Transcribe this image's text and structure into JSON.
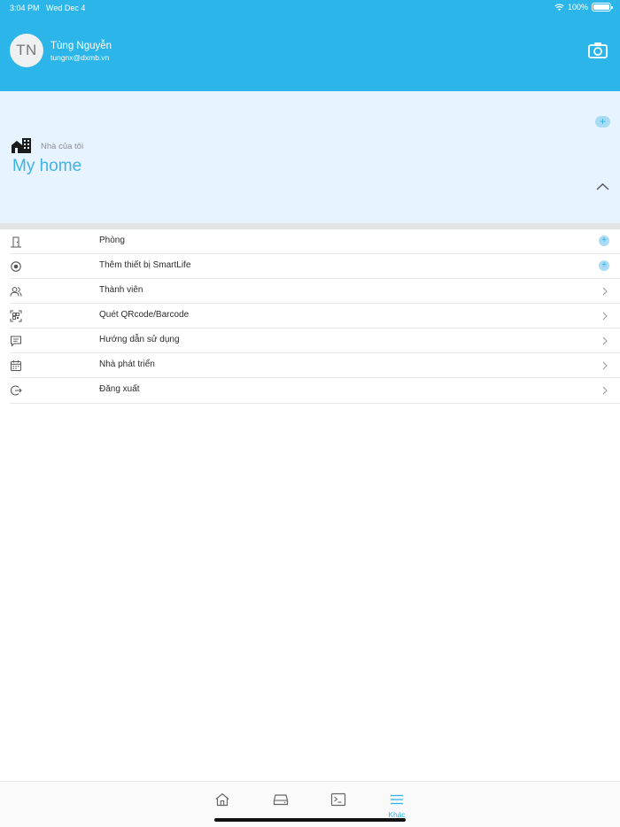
{
  "status_bar": {
    "time": "3:04 PM",
    "date": "Wed Dec 4",
    "battery": "100%",
    "icons": [
      "wifi-icon",
      "battery-icon"
    ]
  },
  "profile": {
    "initials": "TN",
    "name": "Tùng Nguyễn",
    "email": "tungnx@dxmb.vn",
    "camera_icon": "camera-icon"
  },
  "home": {
    "label": "Nhà của tôi",
    "name": "My home",
    "add_symbol": "+",
    "icons": [
      "home-buildings-icon",
      "chevron-up-icon"
    ]
  },
  "menu": {
    "items": [
      {
        "label": "Phòng",
        "icon": "door-icon",
        "action": "add"
      },
      {
        "label": "Thêm thiết bị SmartLife",
        "icon": "target-icon",
        "action": "add"
      },
      {
        "label": "Thành viên",
        "icon": "users-icon",
        "action": "chevron"
      },
      {
        "label": "Quét QRcode/Barcode",
        "icon": "qr-scan-icon",
        "action": "chevron"
      },
      {
        "label": "Hướng dẫn sử dụng",
        "icon": "message-icon",
        "action": "chevron"
      },
      {
        "label": "Nhà phát triển",
        "icon": "calendar-icon",
        "action": "chevron"
      },
      {
        "label": "Đăng xuất",
        "icon": "logout-icon",
        "action": "chevron"
      }
    ],
    "add_symbol": "+"
  },
  "tabbar": {
    "tabs": [
      {
        "icon": "home-icon",
        "label": ""
      },
      {
        "icon": "device-icon",
        "label": ""
      },
      {
        "icon": "terminal-icon",
        "label": ""
      },
      {
        "icon": "menu-lines-icon",
        "label": "Khác",
        "active": true
      }
    ]
  },
  "colors": {
    "header": "#2cb5e9",
    "panel": "#e7f3fe",
    "accent": "#3fb3e6",
    "plus_bg": "#a9dcf3"
  }
}
